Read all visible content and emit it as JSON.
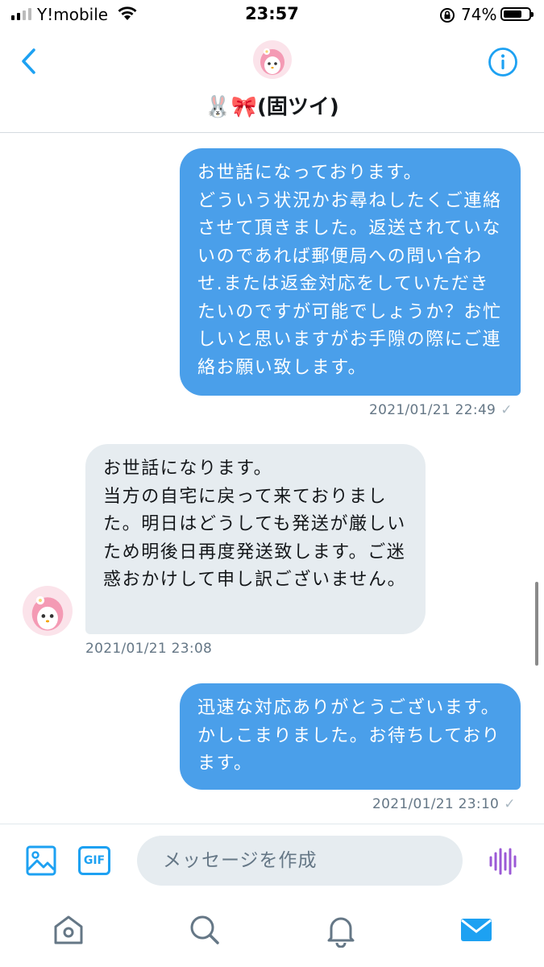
{
  "status_bar": {
    "carrier": "Y!mobile",
    "time": "23:57",
    "battery_percent": "74%",
    "battery_level": 0.74
  },
  "header": {
    "title": "🐰🎀(固ツイ)",
    "back_icon": "chevron-left-icon",
    "info_icon": "info-icon"
  },
  "messages": [
    {
      "direction": "sent",
      "text": "お世話になっております。\nどういう状況かお尋ねしたくご連絡させて頂きました。返送されていないのであれば郵便局への問い合わせ.または返金対応をしていただきたいのですが可能でしょうか？お忙しいと思いますがお手隙の際にご連絡お願い致します。",
      "timestamp": "2021/01/21 22:49",
      "read_mark": "✓"
    },
    {
      "direction": "received",
      "text": "お世話になります。\n当方の自宅に戻って来ておりました。明日はどうしても発送が厳しいため明後日再度発送致します。ご迷惑おかけして申し訳ございません。",
      "timestamp": "2021/01/21 23:08"
    },
    {
      "direction": "sent",
      "text": "迅速な対応ありがとうございます。かしこまりました。お待ちしております。",
      "timestamp": "2021/01/21 23:10",
      "read_mark": "✓"
    }
  ],
  "composer": {
    "placeholder": "メッセージを作成",
    "gif_label": "GIF"
  },
  "bottom_nav": {
    "items": [
      "home-icon",
      "search-icon",
      "notifications-icon",
      "messages-icon"
    ],
    "active": "messages-icon"
  },
  "colors": {
    "accent": "#1da1f2",
    "sent_bubble": "#4a9fea",
    "received_bubble": "#e6ecf0",
    "timestamp": "#657786",
    "voice": "#9b59d6"
  }
}
